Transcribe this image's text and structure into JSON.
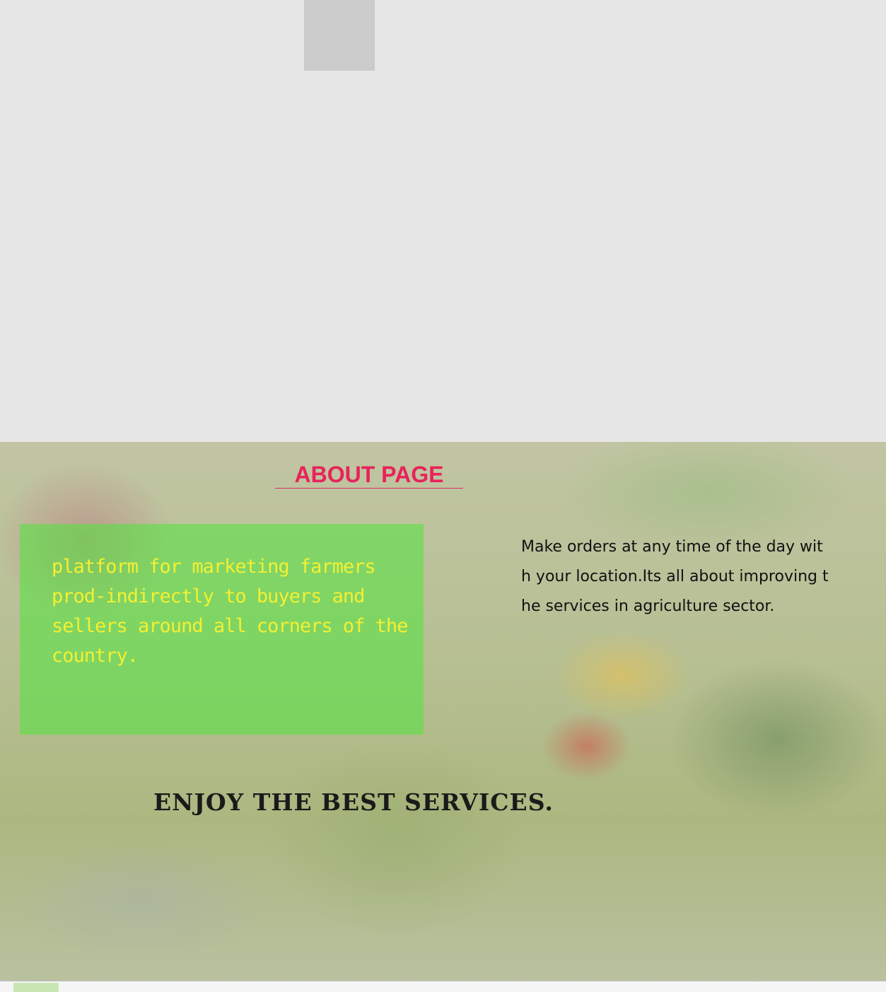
{
  "about": {
    "title": "ABOUT PAGE",
    "green_card_text": "platform for  marketing farmers prod-indirectly to buyers and sellers around all corners of the country.",
    "right_text": "Make orders at any time of the day with your location.Its all about improving the services in agriculture sector.",
    "enjoy_heading": "ENJOY  THE BEST  SERVICES."
  },
  "colors": {
    "page_background": "#e6e6e6",
    "title_color": "#e8235a",
    "card_green": "#50e63c",
    "card_text_yellow": "#f4f030"
  },
  "images": {
    "hero_background": "vegetable-market-photo"
  }
}
